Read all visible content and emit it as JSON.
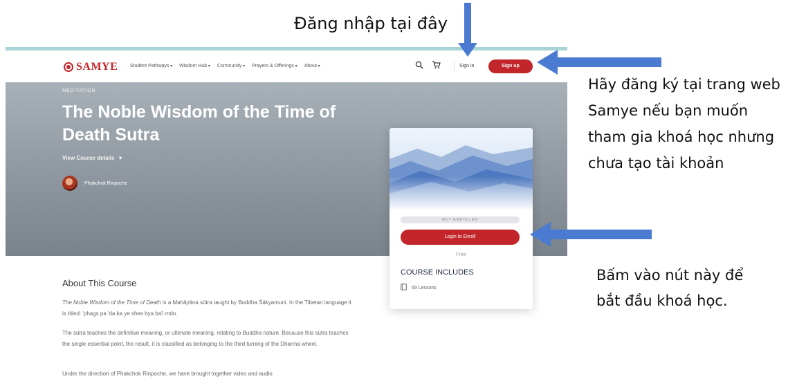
{
  "annotations": {
    "login_here": "Đăng nhập tại đây",
    "signup_note_lines": [
      "Hãy đăng ký tại trang web",
      "Samye nếu bạn muốn",
      "tham gia khoá học nhưng",
      "chưa tạo tài khoản"
    ],
    "enroll_note_lines": [
      "Bấm vào nút này để",
      "bắt đầu khoá học."
    ]
  },
  "navbar": {
    "logo_text": "SAMYE",
    "menu": [
      "Student Pathways",
      "Wisdom Hub",
      "Community",
      "Prayers & Offerings",
      "About"
    ],
    "icons": [
      "search-icon",
      "cart-icon"
    ],
    "sign_in": "Sign in",
    "sign_up": "Sign up"
  },
  "hero": {
    "category": "MEDITATION",
    "title_lines": [
      "The Noble Wisdom of the Time of",
      "Death Sutra"
    ],
    "details_link": "View Course details",
    "teacher_name": "Phakchok Rinpoche"
  },
  "card": {
    "status": "NOT ENROLLED",
    "enroll_button": "Login to Enroll",
    "price": "Free",
    "includes_heading": "COURSE INCLUDES",
    "lessons": "69 Lessons"
  },
  "about": {
    "heading": "About This Course",
    "p1_italic": "The Noble Wisdom of the Time of Death",
    "p1_rest": " is a Mahāyāna sūtra taught by Buddha Śākyamuni. In the Tibetan language it is titled: 'phags pa 'da ka ye shes bya ba'i mdo.",
    "p2": "The sūtra teaches the definitive meaning, or ultimate meaning, relating to Buddha nature. Because this sūtra teaches the single essential point, the result, it is classified as belonging to the third turning of the Dharma wheel.",
    "p3": "Under the direction of Phakchok Rinpoche, we have brought together video and audio"
  },
  "colors": {
    "brand_red": "#c3262a",
    "arrow_blue": "#4a7bd0",
    "hero_gray": "#8e979f",
    "top_line": "#a8d4d6"
  }
}
